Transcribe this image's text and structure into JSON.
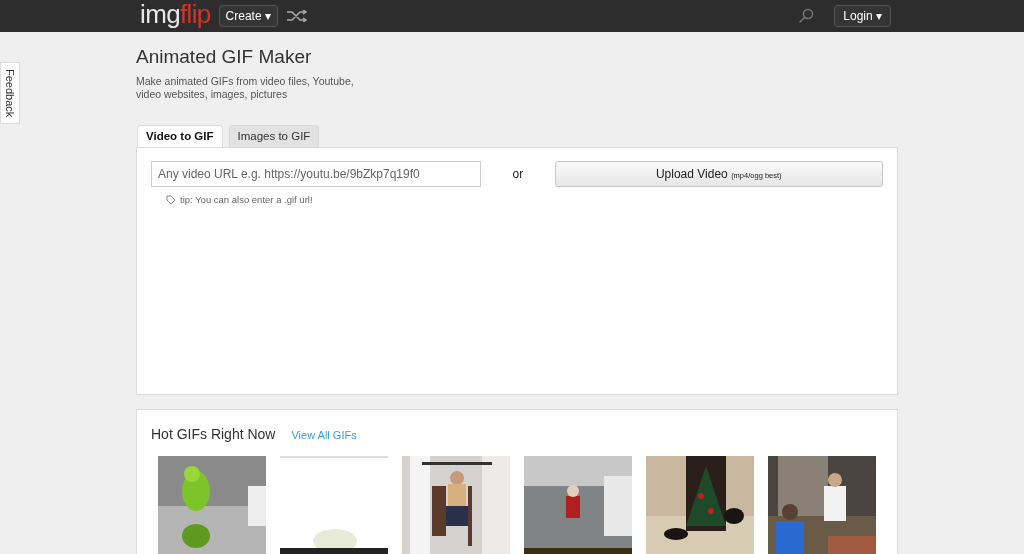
{
  "header": {
    "logo_left": "img",
    "logo_right": "flip",
    "create_button": "Create ▾",
    "login_button": "Login ▾"
  },
  "feedback_tab": "Feedback",
  "title": "Animated GIF Maker",
  "subtitle_lines": [
    "Make animated GIFs from video files, Youtube,",
    "video websites, images, pictures"
  ],
  "tabs": [
    {
      "label": "Video to GIF",
      "selected": true
    },
    {
      "label": "Images to GIF",
      "selected": false
    }
  ],
  "url_field": {
    "placeholder": "Any video URL e.g. https://youtu.be/9bZkp7q19f0"
  },
  "or_text": "or",
  "upload_button": {
    "label": "Upload Video",
    "note": "(mp4/ogg best)"
  },
  "tip": "tip: You can also enter a .gif url!",
  "hot": {
    "title": "Hot GIFs Right Now",
    "link": "View All GIFs"
  }
}
